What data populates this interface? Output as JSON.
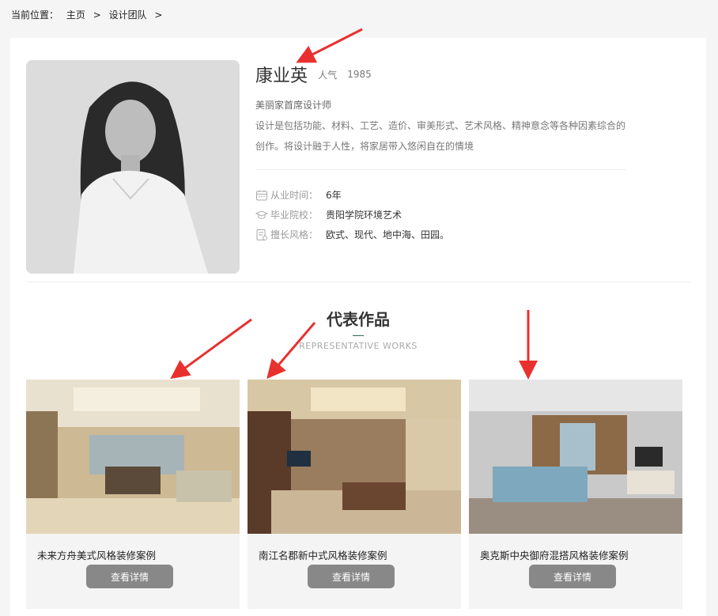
{
  "breadcrumb": {
    "prefix": "当前位置：",
    "home": "主页",
    "sep1": ">",
    "section": "设计团队",
    "sep2": ">"
  },
  "profile": {
    "name": "康业英",
    "popularity_label": "人气",
    "popularity_value": "1985",
    "title": "美丽家首席设计师",
    "intro": "设计是包括功能、材料、工艺、造价、审美形式、艺术风格、精神意念等各种因素综合的创作。将设计融于人性，将家居带入悠闲自在的情境",
    "info": [
      {
        "icon": "calendar-icon",
        "label": "从业时间：",
        "value": "6年"
      },
      {
        "icon": "graduation-cap-icon",
        "label": "毕业院校：",
        "value": "贵阳学院环境艺术"
      },
      {
        "icon": "style-document-icon",
        "label": "擅长风格：",
        "value": "欧式、现代、地中海、田园。"
      }
    ]
  },
  "works_section": {
    "title": "代表作品",
    "subtitle": "REPRESENTATIVE  WORKS",
    "items": [
      {
        "title": "未来方舟美式风格装修案例",
        "button": "查看详情"
      },
      {
        "title": "南江名郡新中式风格装修案例",
        "button": "查看详情"
      },
      {
        "title": "奥克斯中央御府混搭风格装修案例",
        "button": "查看详情"
      }
    ]
  },
  "colors": {
    "accent_line": "#2e6b4f",
    "button_bg": "#888888",
    "annotation_arrow": "#e8312f"
  }
}
